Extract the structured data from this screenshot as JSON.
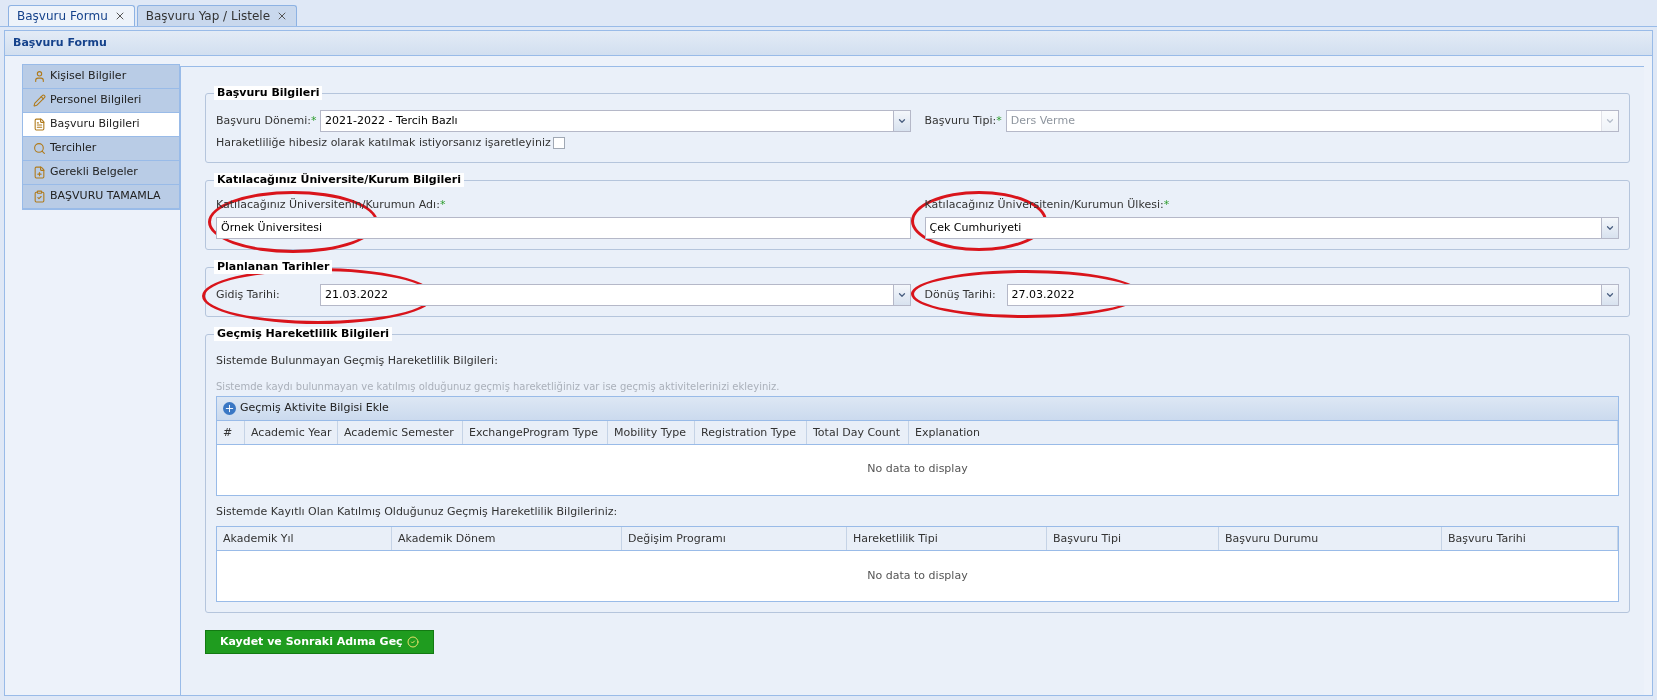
{
  "tabs": [
    {
      "label": "Başvuru Formu",
      "selected": true
    },
    {
      "label": "Başvuru Yap / Listele",
      "selected": false
    }
  ],
  "panel": {
    "title": "Başvuru Formu"
  },
  "sidebar": {
    "items": [
      {
        "label": "Kişisel Bilgiler",
        "selected": false,
        "kind": "person"
      },
      {
        "label": "Personel Bilgileri",
        "selected": false,
        "kind": "edit"
      },
      {
        "label": "Başvuru Bilgileri",
        "selected": true,
        "kind": "form"
      },
      {
        "label": "Tercihler",
        "selected": false,
        "kind": "search"
      },
      {
        "label": "Gerekli Belgeler",
        "selected": false,
        "kind": "doc"
      },
      {
        "label": "BAŞVURU TAMAMLA",
        "selected": false,
        "kind": "check"
      }
    ]
  },
  "application_info": {
    "title": "Başvuru Bilgileri",
    "period": {
      "label": "Başvuru Dönemi:",
      "mark": "*",
      "value": "2021-2022 - Tercih Bazlı",
      "disabled": false
    },
    "type": {
      "label": "Başvuru Tipi:",
      "mark": "*",
      "value": "Ders Verme",
      "disabled": true
    },
    "grant_checkbox": {
      "label": "Haraketliliğe hibesiz olarak katılmak istiyorsanız işaretleyiniz",
      "checked": false
    }
  },
  "institution_info": {
    "title": "Katılacağınız Üniversite/Kurum Bilgileri",
    "name": {
      "label": "Katılacağınız Üniversitenin/Kurumun Adı:",
      "mark": "*",
      "value": "Örnek Üniversitesi",
      "circled": true,
      "dropdown": false
    },
    "country": {
      "label": "Katılacağınız Üniversitenin/Kurumun Ülkesi:",
      "mark": "*",
      "value": "Çek Cumhuriyeti",
      "circled": true,
      "dropdown": true
    }
  },
  "planned_dates": {
    "title": "Planlanan Tarihler",
    "departure": {
      "label": "Gidiş Tarihi:",
      "value": "21.03.2022",
      "circled": true
    },
    "return": {
      "label": "Dönüş Tarihi:",
      "value": "27.03.2022",
      "circled": true
    }
  },
  "past_mobility": {
    "title": "Geçmiş Hareketlilik Bilgileri",
    "unlisted_heading": "Sistemde Bulunmayan Geçmiş Hareketlilik Bilgileri:",
    "hint": "Sistemde kaydı bulunmayan ve katılmış olduğunuz geçmiş hareketliğiniz var ise geçmiş aktivitelerinizi ekleyiniz.",
    "add_button": "Geçmiş Aktivite Bilgisi Ekle",
    "unlisted_table": {
      "columns": [
        "#",
        "Academic Year",
        "Academic Semester",
        "ExchangeProgram Type",
        "Mobility Type",
        "Registration Type",
        "Total Day Count",
        "Explanation"
      ],
      "empty_text": "No data to display"
    },
    "listed_heading": "Sistemde Kayıtlı Olan Katılmış Olduğunuz Geçmiş Hareketlilik Bilgileriniz:",
    "listed_table": {
      "columns": [
        "Akademik Yıl",
        "Akademik Dönem",
        "Değişim Programı",
        "Hareketlilik Tipi",
        "Başvuru Tipi",
        "Başvuru Durumu",
        "Başvuru Tarihi"
      ],
      "empty_text": "No data to display"
    }
  },
  "save_button": "Kaydet ve Sonraki Adıma Geç"
}
